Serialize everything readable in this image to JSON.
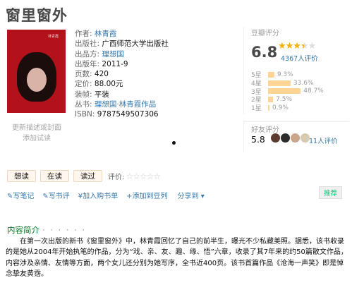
{
  "page_title": "窗里窗外",
  "cover": {
    "small_text": "林青霞"
  },
  "cover_update": "更新描述或封面\n添加试读",
  "info": [
    {
      "label": "作者:",
      "value": "林青霞",
      "link": true
    },
    {
      "label": "出版社:",
      "value": "广西师范大学出版社",
      "link": false
    },
    {
      "label": "出品方:",
      "value": "理想国",
      "link": true
    },
    {
      "label": "出版年:",
      "value": "2011-9",
      "link": false
    },
    {
      "label": "页数:",
      "value": "420",
      "link": false
    },
    {
      "label": "定价:",
      "value": "88.00元",
      "link": false
    },
    {
      "label": "装帧:",
      "value": "平装",
      "link": false
    },
    {
      "label": "丛书:",
      "value": "理想国·林青霞作品",
      "link": true
    },
    {
      "label": "ISBN:",
      "value": "9787549507306",
      "link": false
    }
  ],
  "rating": {
    "title": "豆瓣评分",
    "score": "6.8",
    "stars_filled": 3.5,
    "count_text": "4367人评价",
    "distribution": [
      {
        "label": "5星",
        "pct": "9.3%",
        "value": 9.3
      },
      {
        "label": "4星",
        "pct": "33.6%",
        "value": 33.6
      },
      {
        "label": "3星",
        "pct": "48.7%",
        "value": 48.7
      },
      {
        "label": "2星",
        "pct": "7.5%",
        "value": 7.5
      },
      {
        "label": "1星",
        "pct": "0.9%",
        "value": 0.9
      }
    ]
  },
  "friends": {
    "title": "好友评分",
    "score": "5.8",
    "count_text": "11人评价",
    "avatar_colors": [
      "#5a3b2e",
      "#2b2b2b",
      "#c9a58a",
      "#d8c9b2"
    ]
  },
  "actions": {
    "want": "想读",
    "reading": "在读",
    "read": "读过",
    "eval_label": "评价:",
    "eval_stars": "☆☆☆☆☆"
  },
  "links": {
    "write_note": "✎写笔记",
    "write_review": "✎写书评",
    "add_cart": "¥加入购书单",
    "add_doulist": "+添加到豆列",
    "share": "分享到",
    "recommend": "推荐"
  },
  "intro": {
    "header": "内容简介",
    "dots": "· · · · · ·",
    "text": "在第一次出版的新书《窗里窗外》中，林青霞回忆了自己的前半生，曝光不少私藏美照。据悉，该书收录的是她从2004年开始执笔的作品，分为“戏、亲、友、趣、缘、悟”六章，收录了其7年来的约50篇散文作品，内容涉及亲情、友情等方面，两个女儿还分别为她写序，全书近400页。该书首篇作品《沧海一声笑》即是悼念挚友黄霑。"
  }
}
